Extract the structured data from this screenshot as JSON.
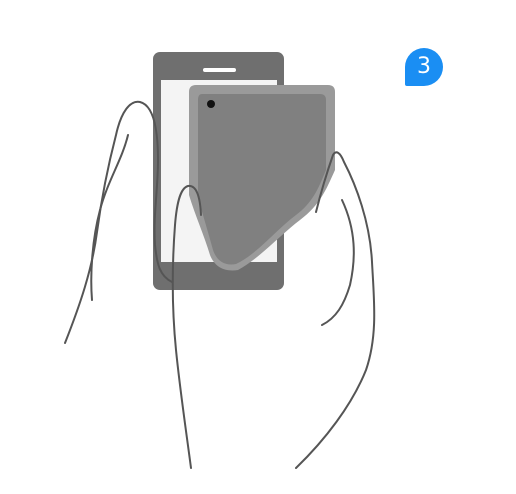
{
  "step": {
    "number": "3"
  },
  "colors": {
    "badge": "#1a8ef3",
    "device_dark": "#6f6f6f",
    "device_body": "#808080",
    "device_frame": "#9a9a9a",
    "screen": "#f4f4f4",
    "hand_outline": "#555555",
    "camera": "#111111"
  },
  "icons": {
    "back_phone": "phone-front-icon",
    "front_phone": "phone-back-icon",
    "camera": "camera-dot-icon"
  }
}
